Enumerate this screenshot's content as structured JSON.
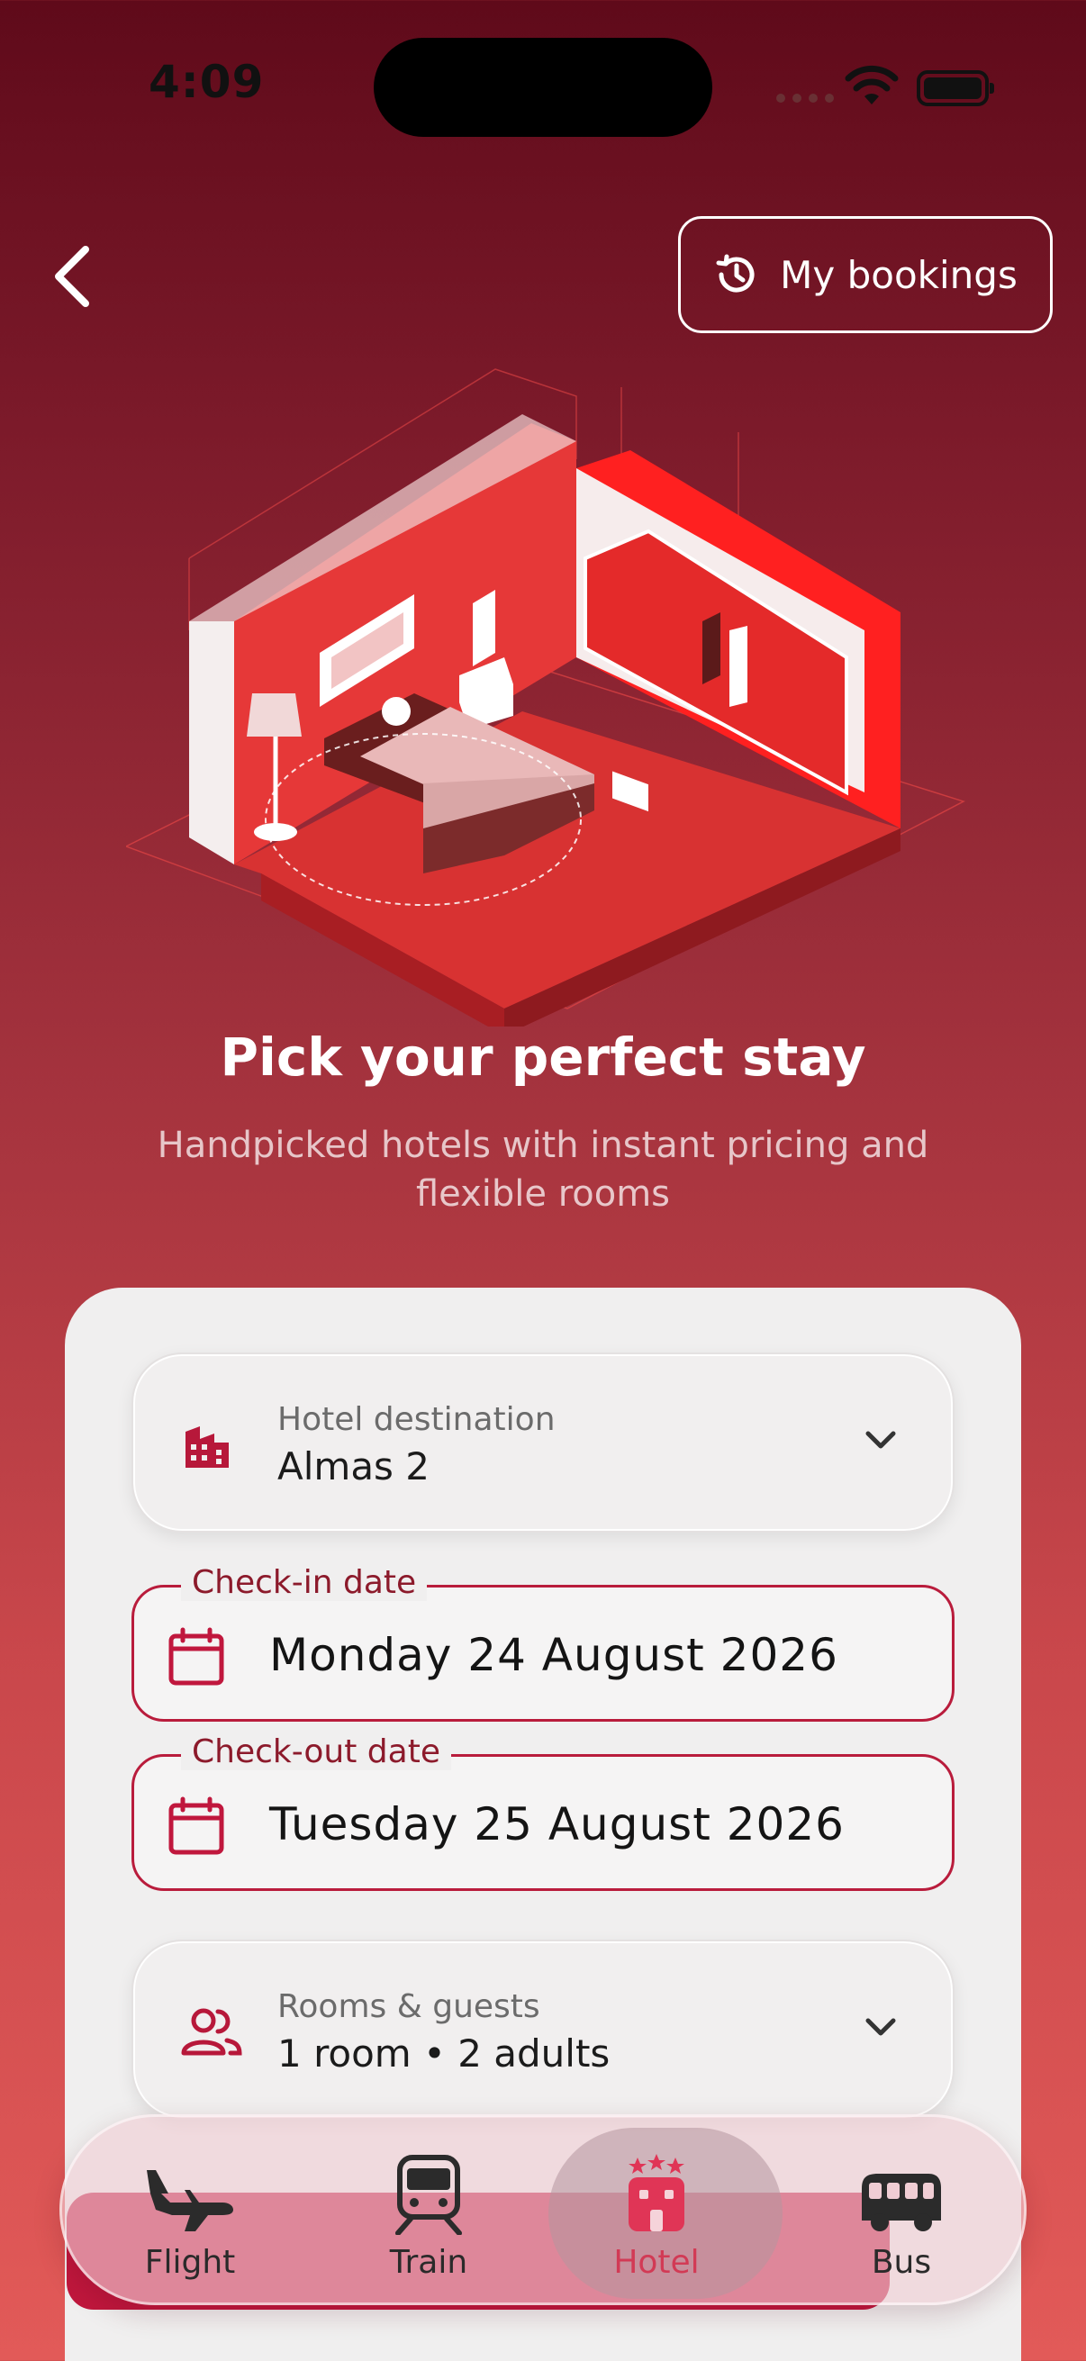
{
  "status_bar": {
    "time": "4:09"
  },
  "header": {
    "bookings_label": "My bookings"
  },
  "hero": {
    "title": "Pick your perfect stay",
    "subtitle": "Handpicked hotels with instant pricing and flexible rooms"
  },
  "form": {
    "destination": {
      "label": "Hotel destination",
      "value": "Almas 2"
    },
    "checkin": {
      "label": "Check-in date",
      "value": "Monday 24 August 2026"
    },
    "checkout": {
      "label": "Check-out date",
      "value": "Tuesday 25 August 2026"
    },
    "guests": {
      "label": "Rooms & guests",
      "value": "1 room • 2 adults"
    }
  },
  "nav": {
    "items": [
      {
        "label": "Flight",
        "icon": "plane-icon",
        "active": false
      },
      {
        "label": "Train",
        "icon": "train-icon",
        "active": false
      },
      {
        "label": "Hotel",
        "icon": "hotel-icon",
        "active": true
      },
      {
        "label": "Bus",
        "icon": "bus-icon",
        "active": false
      }
    ]
  },
  "colors": {
    "accent": "#b91c3c",
    "active_nav": "#d23a55"
  }
}
